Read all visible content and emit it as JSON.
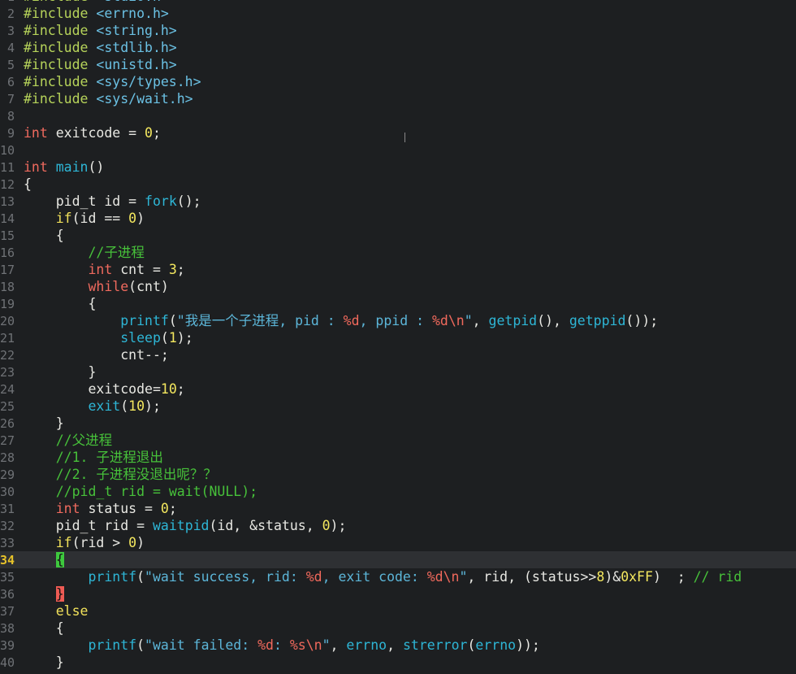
{
  "editor": {
    "colors": {
      "background": "#1d1f21",
      "cursorline": "#2e3033",
      "line_number": "#6f7276",
      "keyword": "#ef6a5e",
      "function": "#2eb6d6",
      "number": "#f4e85f",
      "string": "#5cb6d9",
      "comment": "#47c13a",
      "preprocessor": "#b6d35a"
    },
    "cursor_line": "34",
    "lines": [
      {
        "n": "1",
        "tokens": [
          [
            "pre",
            "#include "
          ],
          [
            "inc",
            "<stdio.h>"
          ]
        ]
      },
      {
        "n": "2",
        "tokens": [
          [
            "pre",
            "#include "
          ],
          [
            "inc",
            "<errno.h>"
          ]
        ]
      },
      {
        "n": "3",
        "tokens": [
          [
            "pre",
            "#include "
          ],
          [
            "inc",
            "<string.h>"
          ]
        ]
      },
      {
        "n": "4",
        "tokens": [
          [
            "pre",
            "#include "
          ],
          [
            "inc",
            "<stdlib.h>"
          ]
        ]
      },
      {
        "n": "5",
        "tokens": [
          [
            "pre",
            "#include "
          ],
          [
            "inc",
            "<unistd.h>"
          ]
        ]
      },
      {
        "n": "6",
        "tokens": [
          [
            "pre",
            "#include "
          ],
          [
            "inc",
            "<sys/types.h>"
          ]
        ]
      },
      {
        "n": "7",
        "tokens": [
          [
            "pre",
            "#include "
          ],
          [
            "inc",
            "<sys/wait.h>"
          ]
        ]
      },
      {
        "n": "8",
        "tokens": []
      },
      {
        "n": "9",
        "tokens": [
          [
            "kw",
            "int"
          ],
          [
            "op",
            " exitcode = "
          ],
          [
            "num",
            "0"
          ],
          [
            "op",
            ";"
          ]
        ]
      },
      {
        "n": "10",
        "tokens": []
      },
      {
        "n": "11",
        "tokens": [
          [
            "kw",
            "int"
          ],
          [
            "op",
            " "
          ],
          [
            "fn",
            "main"
          ],
          [
            "op",
            "()"
          ]
        ]
      },
      {
        "n": "12",
        "tokens": [
          [
            "op",
            "{"
          ]
        ]
      },
      {
        "n": "13",
        "tokens": [
          [
            "op",
            "    pid_t id = "
          ],
          [
            "fn",
            "fork"
          ],
          [
            "op",
            "();"
          ]
        ]
      },
      {
        "n": "14",
        "tokens": [
          [
            "op",
            "    "
          ],
          [
            "ctl",
            "if"
          ],
          [
            "op",
            "(id == "
          ],
          [
            "num",
            "0"
          ],
          [
            "op",
            ")"
          ]
        ]
      },
      {
        "n": "15",
        "tokens": [
          [
            "op",
            "    {"
          ]
        ]
      },
      {
        "n": "16",
        "tokens": [
          [
            "op",
            "        "
          ],
          [
            "cmt",
            "//子进程"
          ]
        ]
      },
      {
        "n": "17",
        "tokens": [
          [
            "op",
            "        "
          ],
          [
            "kw",
            "int"
          ],
          [
            "op",
            " cnt = "
          ],
          [
            "num",
            "3"
          ],
          [
            "op",
            ";"
          ]
        ]
      },
      {
        "n": "18",
        "tokens": [
          [
            "op",
            "        "
          ],
          [
            "kw",
            "while"
          ],
          [
            "op",
            "(cnt)"
          ]
        ]
      },
      {
        "n": "19",
        "tokens": [
          [
            "op",
            "        {"
          ]
        ]
      },
      {
        "n": "20",
        "tokens": [
          [
            "op",
            "            "
          ],
          [
            "fn",
            "printf"
          ],
          [
            "op",
            "("
          ],
          [
            "str",
            "\"我是一个子进程, pid : "
          ],
          [
            "fmt",
            "%d"
          ],
          [
            "str",
            ", ppid : "
          ],
          [
            "fmt",
            "%d\\n"
          ],
          [
            "str",
            "\""
          ],
          [
            "op",
            ", "
          ],
          [
            "fn",
            "getpid"
          ],
          [
            "op",
            "(), "
          ],
          [
            "fn",
            "getppid"
          ],
          [
            "op",
            "());"
          ]
        ]
      },
      {
        "n": "21",
        "tokens": [
          [
            "op",
            "            "
          ],
          [
            "fn",
            "sleep"
          ],
          [
            "op",
            "("
          ],
          [
            "num",
            "1"
          ],
          [
            "op",
            ");"
          ]
        ]
      },
      {
        "n": "22",
        "tokens": [
          [
            "op",
            "            cnt--;"
          ]
        ]
      },
      {
        "n": "23",
        "tokens": [
          [
            "op",
            "        }"
          ]
        ]
      },
      {
        "n": "24",
        "tokens": [
          [
            "op",
            "        exitcode="
          ],
          [
            "num",
            "10"
          ],
          [
            "op",
            ";"
          ]
        ]
      },
      {
        "n": "25",
        "tokens": [
          [
            "op",
            "        "
          ],
          [
            "fn",
            "exit"
          ],
          [
            "op",
            "("
          ],
          [
            "num",
            "10"
          ],
          [
            "op",
            ");"
          ]
        ]
      },
      {
        "n": "26",
        "tokens": [
          [
            "op",
            "    }"
          ]
        ]
      },
      {
        "n": "27",
        "tokens": [
          [
            "op",
            "    "
          ],
          [
            "cmt",
            "//父进程"
          ]
        ]
      },
      {
        "n": "28",
        "tokens": [
          [
            "op",
            "    "
          ],
          [
            "cmt",
            "//1. 子进程退出"
          ]
        ]
      },
      {
        "n": "29",
        "tokens": [
          [
            "op",
            "    "
          ],
          [
            "cmt",
            "//2. 子进程没退出呢？？"
          ]
        ]
      },
      {
        "n": "30",
        "tokens": [
          [
            "op",
            "    "
          ],
          [
            "cmt",
            "//pid_t rid = wait(NULL);"
          ]
        ]
      },
      {
        "n": "31",
        "tokens": [
          [
            "op",
            "    "
          ],
          [
            "kw",
            "int"
          ],
          [
            "op",
            " status = "
          ],
          [
            "num",
            "0"
          ],
          [
            "op",
            ";"
          ]
        ]
      },
      {
        "n": "32",
        "tokens": [
          [
            "op",
            "    pid_t rid = "
          ],
          [
            "fn",
            "waitpid"
          ],
          [
            "op",
            "(id, &status, "
          ],
          [
            "num",
            "0"
          ],
          [
            "op",
            ");"
          ]
        ]
      },
      {
        "n": "33",
        "tokens": [
          [
            "op",
            "    "
          ],
          [
            "ctl",
            "if"
          ],
          [
            "op",
            "(rid > "
          ],
          [
            "num",
            "0"
          ],
          [
            "op",
            ")"
          ]
        ]
      },
      {
        "n": "34",
        "tokens": [
          [
            "op",
            "    "
          ],
          [
            "br-open",
            "{"
          ]
        ]
      },
      {
        "n": "35",
        "tokens": [
          [
            "op",
            "        "
          ],
          [
            "fn",
            "printf"
          ],
          [
            "op",
            "("
          ],
          [
            "str",
            "\"wait success, rid: "
          ],
          [
            "fmt",
            "%d"
          ],
          [
            "str",
            ", exit code: "
          ],
          [
            "fmt",
            "%d\\n"
          ],
          [
            "str",
            "\""
          ],
          [
            "op",
            ", rid, (status>>"
          ],
          [
            "num",
            "8"
          ],
          [
            "op",
            ")&"
          ],
          [
            "num",
            "0xFF"
          ],
          [
            "op",
            ")  ; "
          ],
          [
            "cmt",
            "// rid"
          ]
        ]
      },
      {
        "n": "36",
        "tokens": [
          [
            "op",
            "    "
          ],
          [
            "br-close",
            "}"
          ]
        ]
      },
      {
        "n": "37",
        "tokens": [
          [
            "op",
            "    "
          ],
          [
            "ctl",
            "else"
          ]
        ]
      },
      {
        "n": "38",
        "tokens": [
          [
            "op",
            "    {"
          ]
        ]
      },
      {
        "n": "39",
        "tokens": [
          [
            "op",
            "        "
          ],
          [
            "fn",
            "printf"
          ],
          [
            "op",
            "("
          ],
          [
            "str",
            "\"wait failed: "
          ],
          [
            "fmt",
            "%d"
          ],
          [
            "str",
            ": "
          ],
          [
            "fmt",
            "%s\\n"
          ],
          [
            "str",
            "\""
          ],
          [
            "op",
            ", "
          ],
          [
            "fn",
            "errno"
          ],
          [
            "op",
            ", "
          ],
          [
            "fn",
            "strerror"
          ],
          [
            "op",
            "("
          ],
          [
            "fn",
            "errno"
          ],
          [
            "op",
            "));"
          ]
        ]
      },
      {
        "n": "40",
        "tokens": [
          [
            "op",
            "    }"
          ]
        ]
      }
    ]
  }
}
